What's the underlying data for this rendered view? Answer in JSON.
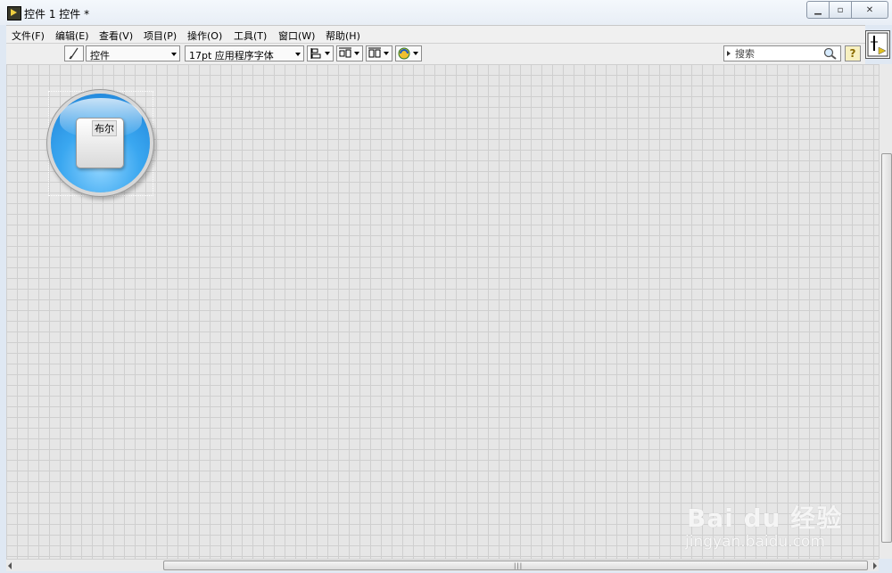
{
  "window": {
    "title": "控件 1 控件 *"
  },
  "menu": {
    "items": [
      "文件(F)",
      "编辑(E)",
      "查看(V)",
      "项目(P)",
      "操作(O)",
      "工具(T)",
      "窗口(W)",
      "帮助(H)"
    ]
  },
  "toolbar": {
    "control_type": "控件",
    "font": "17pt 应用程序字体",
    "search_placeholder": "搜索",
    "help_label": "?"
  },
  "panel": {
    "boolean_label": "布尔"
  },
  "watermark": {
    "brand": "Bai du 经验",
    "url": "jingyan.baidu.com"
  }
}
